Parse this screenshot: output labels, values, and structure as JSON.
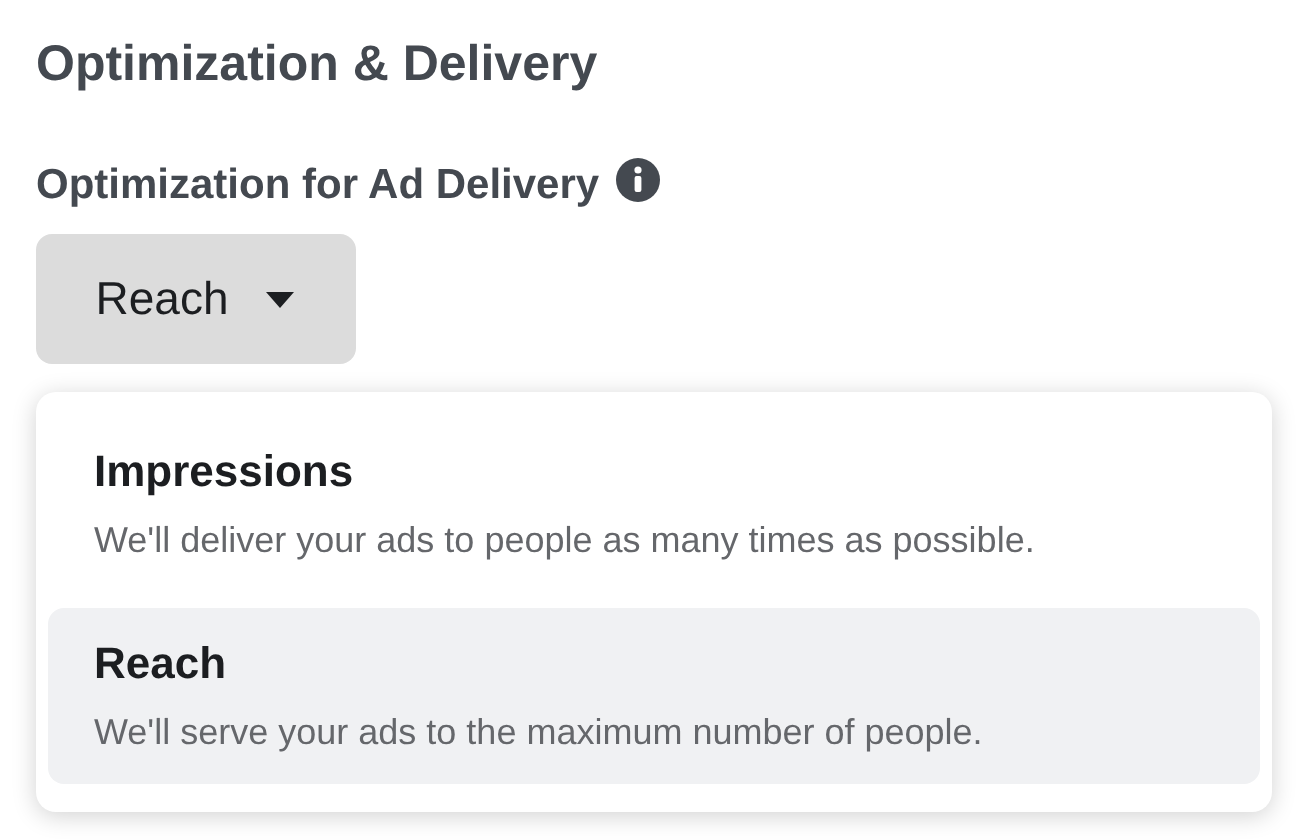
{
  "section_title": "Optimization & Delivery",
  "field_label": "Optimization for Ad Delivery",
  "dropdown": {
    "value": "Reach",
    "expanded": true
  },
  "options": [
    {
      "title": "Impressions",
      "description": "We'll deliver your ads to people as many times as possible.",
      "selected": false
    },
    {
      "title": "Reach",
      "description": "We'll serve your ads to the maximum number of people.",
      "selected": true
    }
  ]
}
